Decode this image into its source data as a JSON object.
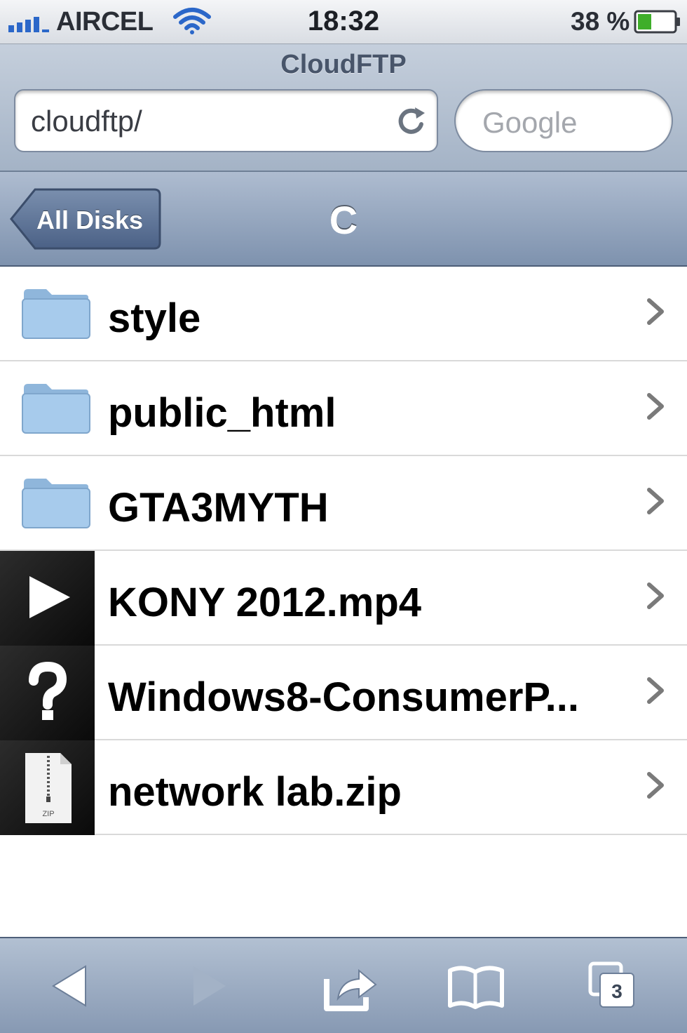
{
  "status_bar": {
    "carrier": "AIRCEL",
    "time": "18:32",
    "battery_percent": "38 %",
    "battery_level": 0.38
  },
  "browser": {
    "title": "CloudFTP",
    "url": "cloudftp/",
    "search_placeholder": "Google"
  },
  "nav": {
    "back_label": "All Disks",
    "title": "C"
  },
  "files": [
    {
      "name": "style",
      "icon": "folder-icon"
    },
    {
      "name": "public_html",
      "icon": "folder-icon"
    },
    {
      "name": "GTA3MYTH",
      "icon": "folder-icon"
    },
    {
      "name": "KONY 2012.mp4",
      "icon": "play-icon"
    },
    {
      "name": "Windows8-ConsumerP...",
      "icon": "question-mark-icon"
    },
    {
      "name": "network lab.zip",
      "icon": "zip-file-icon",
      "icon_label": "ZIP"
    }
  ],
  "toolbar": {
    "tab_count": "3",
    "items": [
      "back-icon",
      "forward-icon",
      "share-icon",
      "bookmarks-icon",
      "tabs-icon"
    ]
  },
  "colors": {
    "nav_bar": "#7e92ae",
    "folder_blue": "#9cc3e6",
    "list_separator": "#d9d9d9"
  }
}
